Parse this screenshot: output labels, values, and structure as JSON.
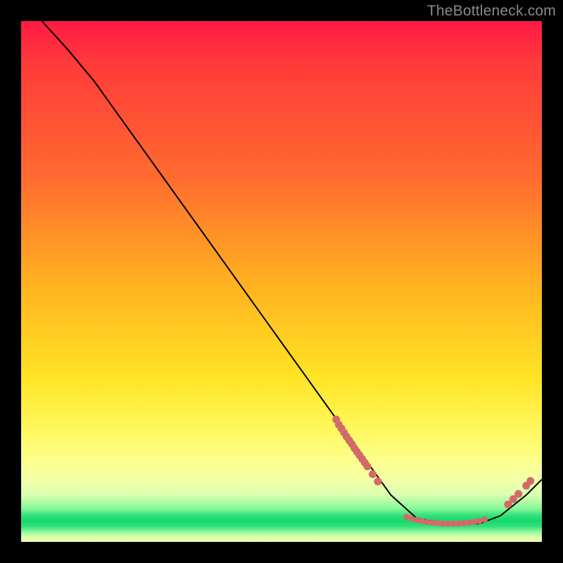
{
  "attribution": "TheBottleneck.com",
  "chart_data": {
    "type": "line",
    "title": "",
    "xlabel": "",
    "ylabel": "",
    "xlim": [
      0,
      100
    ],
    "ylim": [
      0,
      100
    ],
    "curve": [
      {
        "x": 4,
        "y": 100
      },
      {
        "x": 9,
        "y": 94.5
      },
      {
        "x": 14,
        "y": 88.5
      },
      {
        "x": 71,
        "y": 9
      },
      {
        "x": 76,
        "y": 4.5
      },
      {
        "x": 82,
        "y": 3.5
      },
      {
        "x": 88,
        "y": 3.5
      },
      {
        "x": 92,
        "y": 5
      },
      {
        "x": 97,
        "y": 9
      },
      {
        "x": 100,
        "y": 12
      }
    ],
    "markers_left_cluster": [
      {
        "x": 60.5,
        "y": 23.5
      },
      {
        "x": 61.0,
        "y": 22.5
      },
      {
        "x": 61.5,
        "y": 21.8
      },
      {
        "x": 62.0,
        "y": 21.0
      },
      {
        "x": 62.5,
        "y": 20.2
      },
      {
        "x": 63.0,
        "y": 19.5
      },
      {
        "x": 63.5,
        "y": 18.8
      },
      {
        "x": 64.0,
        "y": 18.0
      },
      {
        "x": 64.5,
        "y": 17.3
      },
      {
        "x": 65.0,
        "y": 16.6
      },
      {
        "x": 65.5,
        "y": 15.9
      },
      {
        "x": 66.0,
        "y": 15.2
      },
      {
        "x": 66.5,
        "y": 14.5
      },
      {
        "x": 67.5,
        "y": 13.0
      },
      {
        "x": 68.5,
        "y": 11.6
      }
    ],
    "markers_bottom_cluster": [
      {
        "x": 74.0,
        "y": 4.8
      },
      {
        "x": 75.0,
        "y": 4.5
      },
      {
        "x": 76.0,
        "y": 4.2
      },
      {
        "x": 77.0,
        "y": 4.0
      },
      {
        "x": 78.0,
        "y": 3.8
      },
      {
        "x": 79.0,
        "y": 3.7
      },
      {
        "x": 80.0,
        "y": 3.6
      },
      {
        "x": 81.0,
        "y": 3.5
      },
      {
        "x": 82.0,
        "y": 3.5
      },
      {
        "x": 83.0,
        "y": 3.5
      },
      {
        "x": 84.0,
        "y": 3.5
      },
      {
        "x": 85.0,
        "y": 3.6
      },
      {
        "x": 86.0,
        "y": 3.7
      },
      {
        "x": 87.0,
        "y": 3.8
      },
      {
        "x": 88.0,
        "y": 4.0
      },
      {
        "x": 89.0,
        "y": 4.3
      }
    ],
    "markers_right_cluster": [
      {
        "x": 93.5,
        "y": 7.2
      },
      {
        "x": 94.5,
        "y": 8.2
      },
      {
        "x": 95.5,
        "y": 9.2
      },
      {
        "x": 97.0,
        "y": 10.8
      },
      {
        "x": 97.8,
        "y": 11.7
      }
    ]
  }
}
